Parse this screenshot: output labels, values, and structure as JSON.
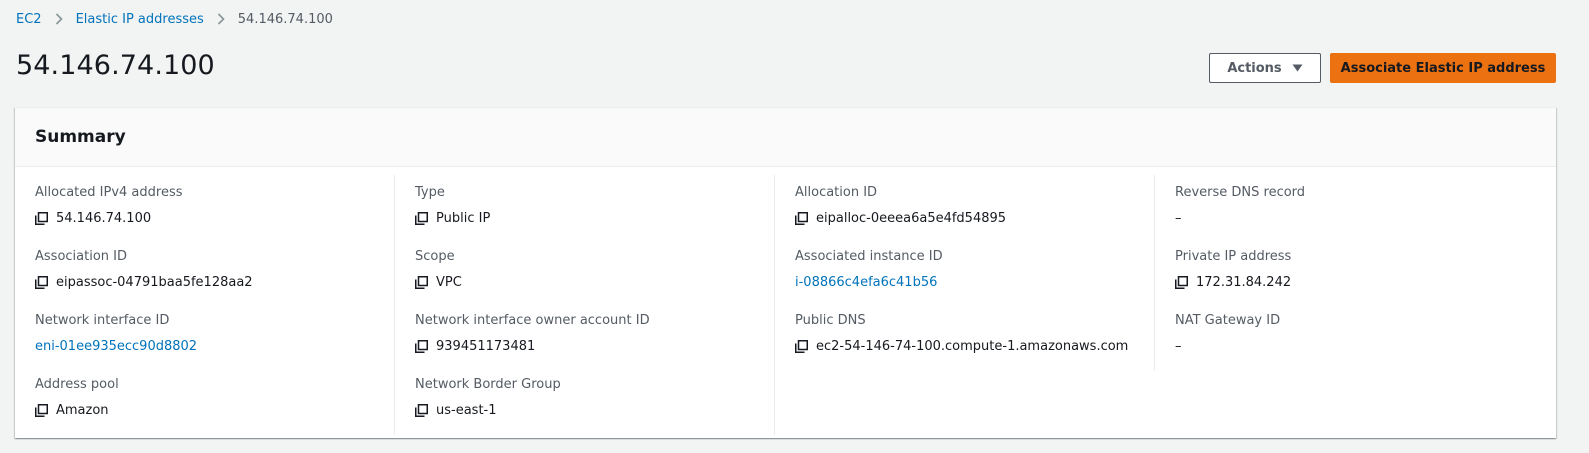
{
  "breadcrumb": {
    "items": [
      "EC2",
      "Elastic IP addresses"
    ],
    "current": "54.146.74.100"
  },
  "page": {
    "title": "54.146.74.100"
  },
  "actions": {
    "actions_label": "Actions",
    "associate_label": "Associate Elastic IP address"
  },
  "summary": {
    "title": "Summary",
    "columns": [
      [
        {
          "label": "Allocated IPv4 address",
          "value": "54.146.74.100",
          "copy": true,
          "link": false
        },
        {
          "label": "Association ID",
          "value": "eipassoc-04791baa5fe128aa2",
          "copy": true,
          "link": false
        },
        {
          "label": "Network interface ID",
          "value": "eni-01ee935ecc90d8802",
          "copy": false,
          "link": true
        },
        {
          "label": "Address pool",
          "value": "Amazon",
          "copy": true,
          "link": false
        }
      ],
      [
        {
          "label": "Type",
          "value": "Public IP",
          "copy": true,
          "link": false
        },
        {
          "label": "Scope",
          "value": "VPC",
          "copy": true,
          "link": false
        },
        {
          "label": "Network interface owner account ID",
          "value": "939451173481",
          "copy": true,
          "link": false
        },
        {
          "label": "Network Border Group",
          "value": "us-east-1",
          "copy": true,
          "link": false
        }
      ],
      [
        {
          "label": "Allocation ID",
          "value": "eipalloc-0eeea6a5e4fd54895",
          "copy": true,
          "link": false
        },
        {
          "label": "Associated instance ID",
          "value": "i-08866c4efa6c41b56",
          "copy": false,
          "link": true
        },
        {
          "label": "Public DNS",
          "value": "ec2-54-146-74-100.compute-1.amazonaws.com",
          "copy": true,
          "link": false
        }
      ],
      [
        {
          "label": "Reverse DNS record",
          "value": "–",
          "copy": false,
          "link": false
        },
        {
          "label": "Private IP address",
          "value": "172.31.84.242",
          "copy": true,
          "link": false
        },
        {
          "label": "NAT Gateway ID",
          "value": "–",
          "copy": false,
          "link": false
        }
      ]
    ]
  },
  "colors": {
    "link": "#0073bb",
    "primary_button": "#ec7211",
    "background": "#f2f3f3"
  }
}
